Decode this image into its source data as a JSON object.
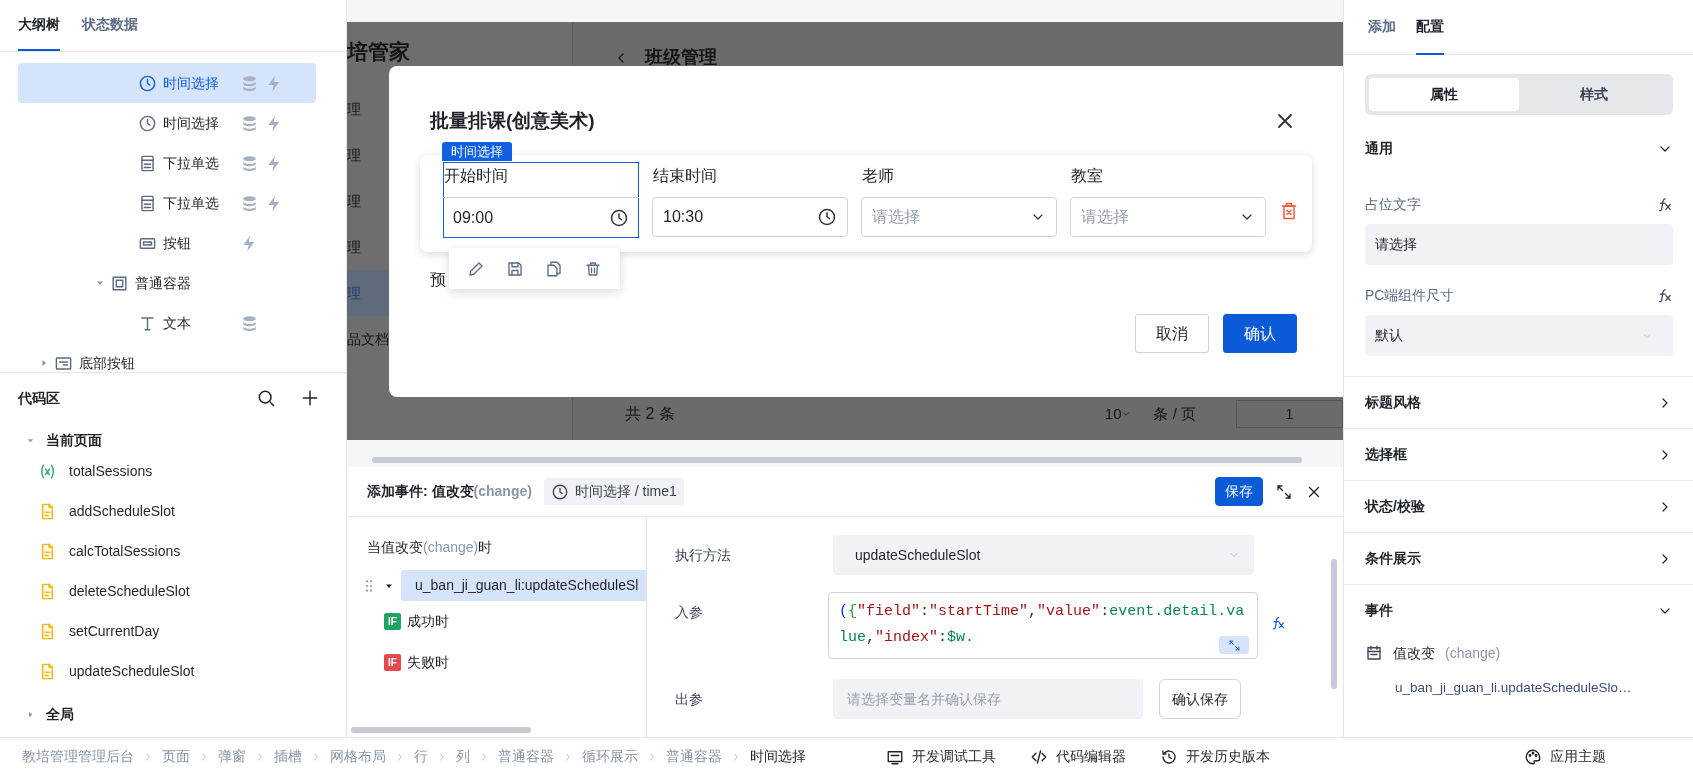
{
  "outline_panel": {
    "tabs": [
      {
        "label": "大纲树",
        "selected": true
      },
      {
        "label": "状态数据",
        "selected": false
      }
    ],
    "tree": [
      {
        "children": [
          {
            "children": [
              {
                "children": [
                  {
                    "label": "时间选择",
                    "kind": "clock",
                    "selected": true,
                    "bound_data": true,
                    "has_event": true
                  },
                  {
                    "label": "时间选择",
                    "kind": "clock",
                    "selected": false,
                    "bound_data": true,
                    "has_event": true
                  },
                  {
                    "label": "下拉单选",
                    "kind": "dropdown",
                    "selected": false,
                    "bound_data": true,
                    "has_event": true
                  },
                  {
                    "label": "下拉单选",
                    "kind": "dropdown",
                    "selected": false,
                    "bound_data": true,
                    "has_event": true
                  },
                  {
                    "label": "按钮",
                    "kind": "button",
                    "selected": false,
                    "bound_data": false,
                    "has_event": true
                  }
                ]
              },
              {
                "label": "普通容器",
                "kind": "container",
                "selected": false,
                "expanded": true,
                "bound_data": false,
                "has_event": false,
                "children": [
                  {
                    "label": "文本",
                    "kind": "text",
                    "selected": false,
                    "bound_data": true,
                    "has_event": false
                  }
                ]
              }
            ]
          }
        ]
      },
      {
        "label": "底部按钮",
        "kind": "footer",
        "selected": false,
        "expanded": false,
        "bound_data": false,
        "has_event": false
      }
    ]
  },
  "code_panel": {
    "title": "代码区",
    "groups": [
      {
        "label": "当前页面",
        "expanded": true,
        "items": [
          {
            "kind": "variable",
            "label": "totalSessions"
          },
          {
            "kind": "function",
            "label": "addScheduleSlot"
          },
          {
            "kind": "function",
            "label": "calcTotalSessions"
          },
          {
            "kind": "function",
            "label": "deleteScheduleSlot"
          },
          {
            "kind": "function",
            "label": "setCurrentDay"
          },
          {
            "kind": "function",
            "label": "updateScheduleSlot"
          }
        ]
      },
      {
        "label": "全局",
        "expanded": false
      }
    ]
  },
  "canvas": {
    "brand": "培管家",
    "page_title": "班级管理",
    "nav": [
      {
        "label": "理",
        "selected": false
      },
      {
        "label": "理",
        "selected": false
      },
      {
        "label": "理",
        "selected": false
      },
      {
        "label": "理",
        "selected": false
      },
      {
        "label": "理",
        "selected": true
      },
      {
        "label": "品文档",
        "selected": false
      }
    ],
    "total": "共 2 条",
    "page_size": "10",
    "page_size_unit": "条 / 页",
    "page": "1"
  },
  "modal": {
    "title": "批量排课(创意美术)",
    "component_tag": "时间选择",
    "fields": [
      {
        "label": "开始时间",
        "kind": "time",
        "value": "09:00",
        "selected": true
      },
      {
        "label": "结束时间",
        "kind": "time",
        "value": "10:30",
        "selected": false
      },
      {
        "label": "老师",
        "kind": "select",
        "placeholder": "请选择",
        "selected": false
      },
      {
        "label": "教室",
        "kind": "select",
        "placeholder": "请选择",
        "selected": false
      }
    ],
    "note": "预",
    "buttons": [
      {
        "label": "取消",
        "kind": "secondary"
      },
      {
        "label": "确认",
        "kind": "primary"
      }
    ]
  },
  "event_panel": {
    "title": "添加事件: 值改变",
    "event_code": "(change)",
    "component": "时间选择 / time1",
    "save": "保存",
    "trigger": {
      "before": "当值改变",
      "code": "(change)",
      "after": "时"
    },
    "action": {
      "label": "u_ban_ji_guan_li:updateScheduleSl",
      "expanded": true,
      "selected": true,
      "branches": [
        {
          "badge": "IF",
          "label": "成功时",
          "kind": "success"
        },
        {
          "badge": "IF",
          "label": "失败时",
          "kind": "fail"
        }
      ]
    },
    "method": {
      "label": "执行方法",
      "value": "updateScheduleSlot"
    },
    "input": {
      "label": "入参",
      "code": "({\"field\":\"startTime\",\"value\":event.detail.value,\"index\":$w."
    },
    "output": {
      "label": "出参",
      "placeholder": "请选择变量名并确认保存",
      "button": "确认保存"
    }
  },
  "config_panel": {
    "tabs": [
      {
        "label": "添加",
        "selected": false
      },
      {
        "label": "配置",
        "selected": true
      }
    ],
    "segments": [
      {
        "label": "属性",
        "selected": true
      },
      {
        "label": "样式",
        "selected": false
      }
    ],
    "sections": [
      {
        "title": "通用",
        "expanded": true,
        "fields": [
          {
            "label": "占位文字",
            "kind": "input",
            "value": "请选择"
          },
          {
            "label": "PC端组件尺寸",
            "kind": "select",
            "value": "默认"
          }
        ]
      },
      {
        "title": "标题风格",
        "expanded": false
      },
      {
        "title": "选择框",
        "expanded": false
      },
      {
        "title": "状态/校验",
        "expanded": false
      },
      {
        "title": "条件展示",
        "expanded": false
      },
      {
        "title": "事件",
        "expanded": true,
        "events": [
          {
            "label": "值改变",
            "code": "(change)",
            "binding": "u_ban_ji_guan_li.updateScheduleSlo…"
          }
        ]
      }
    ]
  },
  "bottom_bar": {
    "breadcrumbs": [
      {
        "label": "教培管理管理后台",
        "selected": false
      },
      {
        "label": "页面",
        "selected": false
      },
      {
        "label": "弹窗",
        "selected": false
      },
      {
        "label": "插槽",
        "selected": false
      },
      {
        "label": "网格布局",
        "selected": false
      },
      {
        "label": "行",
        "selected": false
      },
      {
        "label": "列",
        "selected": false
      },
      {
        "label": "普通容器",
        "selected": false
      },
      {
        "label": "循环展示",
        "selected": false
      },
      {
        "label": "普通容器",
        "selected": false
      },
      {
        "label": "时间选择",
        "selected": true
      }
    ],
    "tools": [
      {
        "kind": "debug",
        "label": "开发调试工具"
      },
      {
        "kind": "code",
        "label": "代码编辑器"
      },
      {
        "kind": "history",
        "label": "开发历史版本"
      },
      {
        "kind": "theme",
        "label": "应用主题"
      }
    ]
  }
}
